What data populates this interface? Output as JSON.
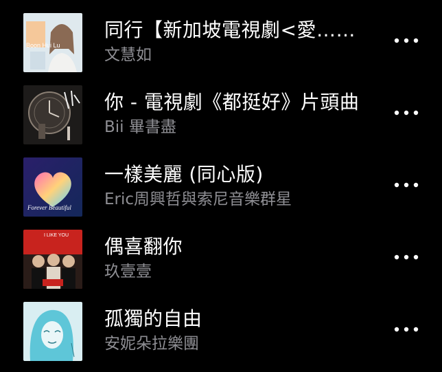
{
  "songs": [
    {
      "title": "同行【新加坡電視劇<愛……",
      "artist": "文慧如",
      "cover_text": "Boon Hui Lu"
    },
    {
      "title": "你 - 電視劇《都挺好》片頭曲",
      "artist": "Bii 畢書盡"
    },
    {
      "title": "一樣美麗 (同心版)",
      "artist": "Eric周興哲與索尼音樂群星",
      "cover_text": "Forever Beautiful"
    },
    {
      "title": "偶喜翻你",
      "artist": "玖壹壹",
      "cover_text": "I LIKE YOU"
    },
    {
      "title": "孤獨的自由",
      "artist": "安妮朵拉樂團"
    }
  ],
  "more_icon": "ellipsis-horizontal-icon"
}
